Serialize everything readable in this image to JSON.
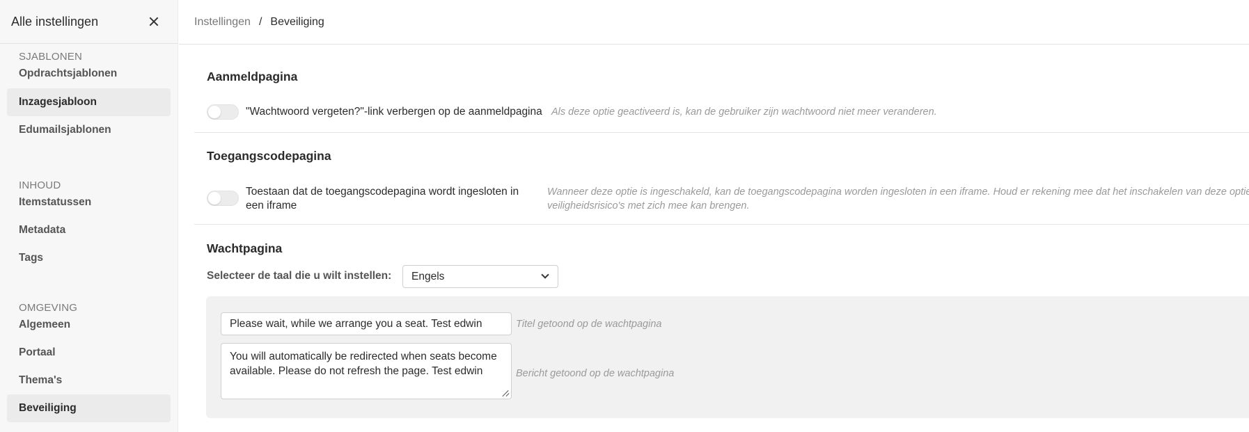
{
  "sidebar": {
    "title": "Alle instellingen",
    "close_icon": "close-icon",
    "sections": [
      {
        "label": "SJABLONEN",
        "items": [
          "Opdrachtsjablonen",
          "Inzagesjabloon",
          "Edumailsjablonen"
        ]
      },
      {
        "label": "INHOUD",
        "items": [
          "Itemstatussen",
          "Metadata",
          "Tags"
        ]
      },
      {
        "label": "OMGEVING",
        "items": [
          "Algemeen",
          "Portaal",
          "Thema's",
          "Beveiliging"
        ]
      }
    ]
  },
  "breadcrumb": {
    "parent": "Instellingen",
    "separator": "/",
    "current": "Beveiliging"
  },
  "login_page": {
    "title": "Aanmeldpagina",
    "toggle_label": "\"Wachtwoord vergeten?\"-link verbergen op de aanmeldpagina",
    "hint": "Als deze optie geactiveerd is, kan de gebruiker zijn wachtwoord niet meer veranderen.",
    "enabled": false
  },
  "access_code_page": {
    "title": "Toegangscodepagina",
    "toggle_label_line1": "Toestaan dat de toegangscodepagina wordt ingesloten in",
    "toggle_label_line2": "een iframe",
    "hint_line1": "Wanneer deze optie is ingeschakeld, kan de toegangscodepagina worden ingesloten in een iframe. Houd er rekening mee dat het inschakelen van deze optie",
    "hint_line2": "veiligheidsrisico's met zich mee kan brengen.",
    "enabled": false
  },
  "waiting_page": {
    "title": "Wachtpagina",
    "language_label": "Selecteer de taal die u wilt instellen:",
    "language_value": "Engels",
    "title_value": "Please wait, while we arrange you a seat. Test edwin",
    "title_hint": "Titel getoond op de wachtpagina",
    "message_value": "You will automatically be redirected when seats become available. Please do not refresh the page. Test edwin",
    "message_hint": "Bericht getoond op de wachtpagina"
  },
  "colors": {
    "sidebar_bg": "#f7f7f7",
    "active_item_bg": "#ebebeb",
    "panel_bg": "#f1f1f1",
    "hint_text": "#9a9a9a"
  }
}
